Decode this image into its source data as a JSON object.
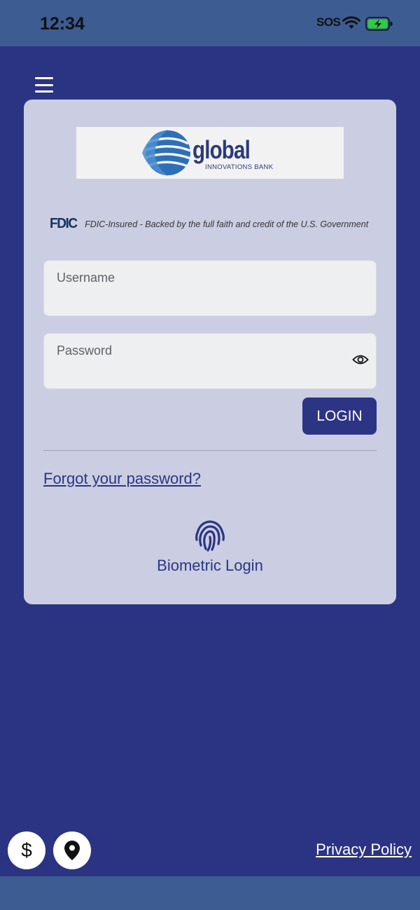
{
  "status": {
    "time": "12:34",
    "sos": "SOS"
  },
  "brand": {
    "name": "global",
    "subtitle": "INNOVATIONS BANK"
  },
  "fdic": {
    "logo": "FDIC",
    "text": "FDIC-Insured - Backed by the full faith and credit of the U.S. Government"
  },
  "login_form": {
    "username_placeholder": "Username",
    "password_placeholder": "Password",
    "login_label": "LOGIN",
    "forgot_label": "Forgot your password?",
    "biometric_label": "Biometric Login"
  },
  "footer": {
    "dollar_symbol": "$",
    "privacy_label": "Privacy Policy"
  },
  "icons": [
    "menu-icon",
    "eye-icon",
    "fingerprint-icon",
    "dollar-icon",
    "location-pin-icon",
    "wifi-icon",
    "battery-icon"
  ],
  "colors": {
    "primary": "#2c3584",
    "background": "#2b3482",
    "card": "#cbcee2",
    "status_bar": "#3d5c92"
  }
}
